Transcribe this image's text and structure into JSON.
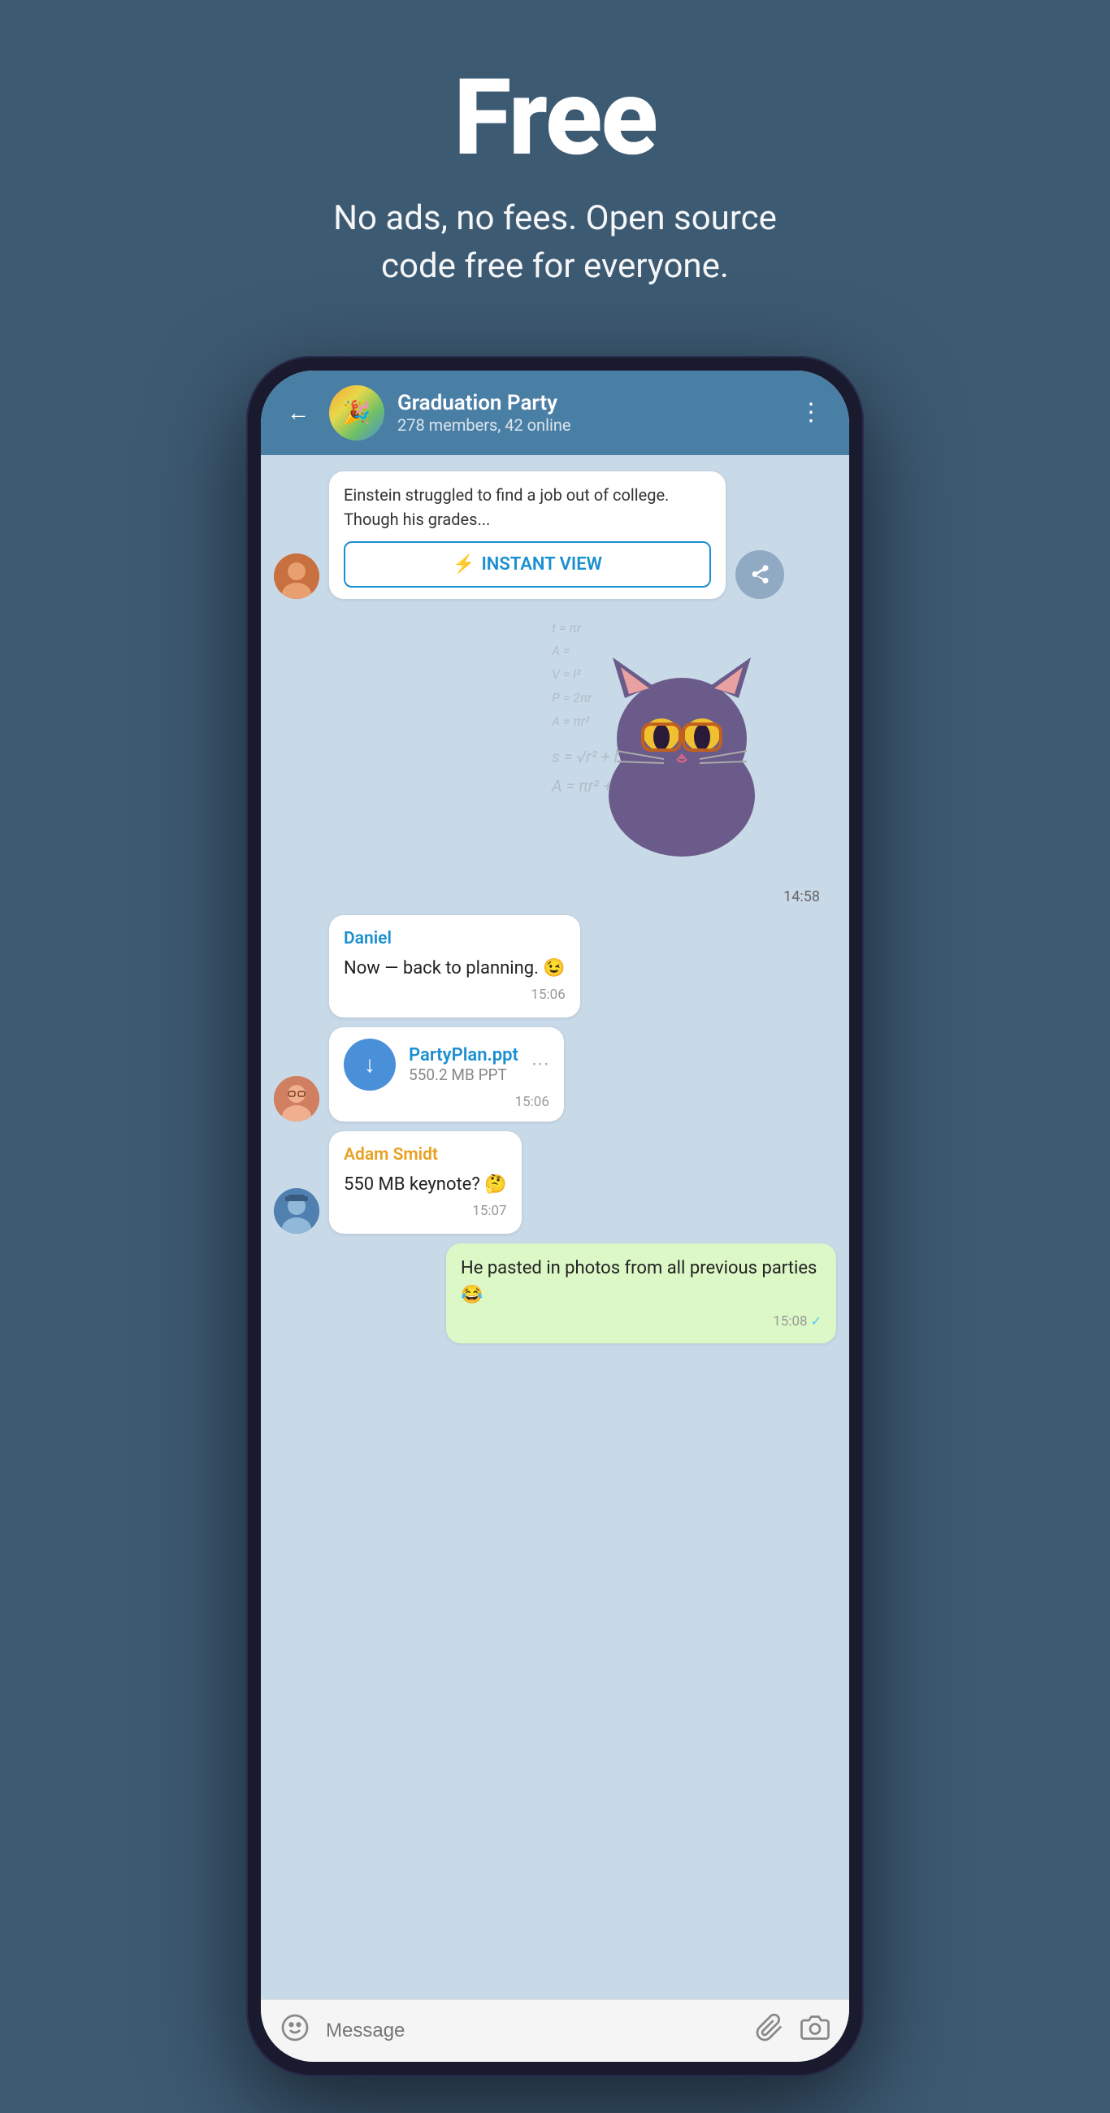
{
  "hero": {
    "title": "Free",
    "subtitle": "No ads, no fees. Open source\ncode free for everyone."
  },
  "chat": {
    "back_label": "←",
    "name": "Graduation Party",
    "status": "278 members, 42 online",
    "more_icon": "⋮",
    "messages": [
      {
        "id": "link-preview",
        "type": "link",
        "side": "left",
        "has_avatar": true,
        "avatar_style": "gradient-1",
        "preview_text": "Einstein struggled to find a job out of college. Though his grades...",
        "instant_view_label": "INSTANT VIEW"
      },
      {
        "id": "sticker",
        "type": "sticker",
        "side": "right",
        "time": "14:58"
      },
      {
        "id": "daniel-msg",
        "type": "text",
        "side": "left",
        "has_avatar": false,
        "sender": "Daniel",
        "sender_color": "blue",
        "text": "Now — back to planning. 😉",
        "time": "15:06"
      },
      {
        "id": "file-msg",
        "type": "file",
        "side": "left",
        "has_avatar": true,
        "avatar_style": "gradient-3",
        "file_name": "PartyPlan.ppt",
        "file_size": "550.2 MB PPT",
        "time": "15:06"
      },
      {
        "id": "adam-msg",
        "type": "text",
        "side": "left",
        "has_avatar": true,
        "avatar_style": "gradient-4",
        "sender": "Adam Smidt",
        "sender_color": "orange",
        "text": "550 MB keynote? 🤔",
        "time": "15:07"
      },
      {
        "id": "own-msg",
        "type": "text",
        "side": "right",
        "bubble_color": "green",
        "text": "He pasted in photos from all previous parties 😂",
        "time": "15:08",
        "has_check": true
      }
    ]
  },
  "input_bar": {
    "placeholder": "Message",
    "emoji_icon": "emoji",
    "attach_icon": "attach",
    "camera_icon": "camera"
  }
}
